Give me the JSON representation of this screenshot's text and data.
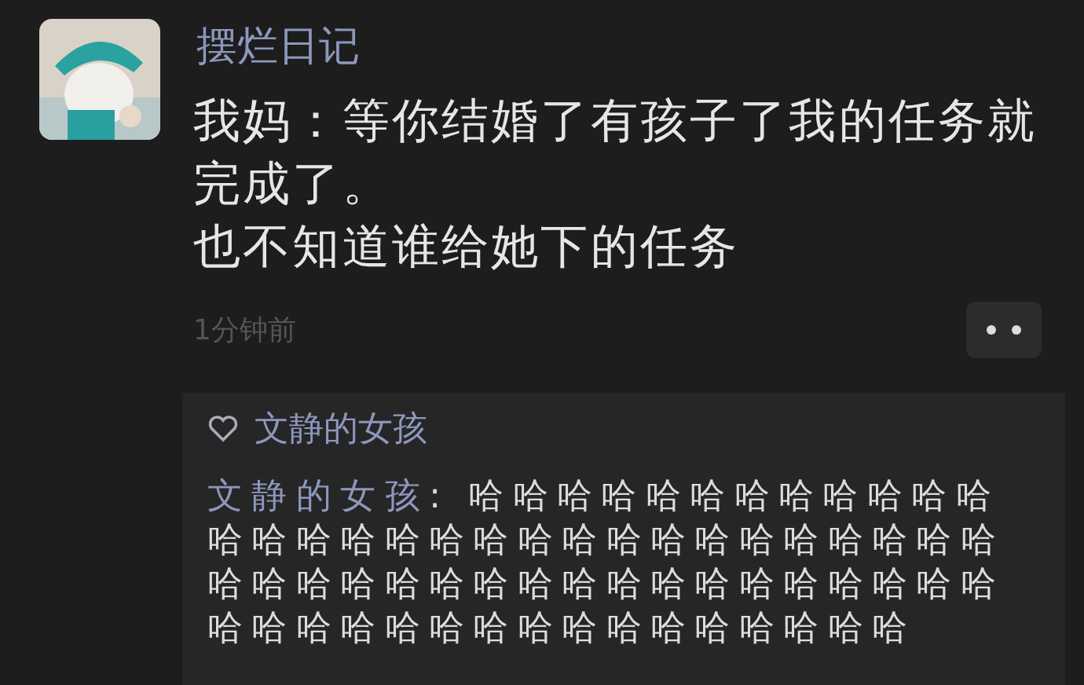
{
  "post": {
    "author": "摆烂日记",
    "paragraphs": [
      "我妈：等你结婚了有孩子了我的任务就完成了。",
      "也不知道谁给她下的任务"
    ],
    "time": "1分钟前"
  },
  "likes": [
    {
      "name": "文静的女孩"
    }
  ],
  "comments": [
    {
      "author": "文静的女孩",
      "separator": ": ",
      "text": "哈哈哈哈哈哈哈哈哈哈哈哈哈哈哈哈哈哈哈哈哈哈哈哈哈哈哈哈哈哈哈哈哈哈哈哈哈哈哈哈哈哈哈哈哈哈哈哈哈哈哈哈哈哈哈哈哈哈哈哈哈哈哈哈"
    }
  ]
}
